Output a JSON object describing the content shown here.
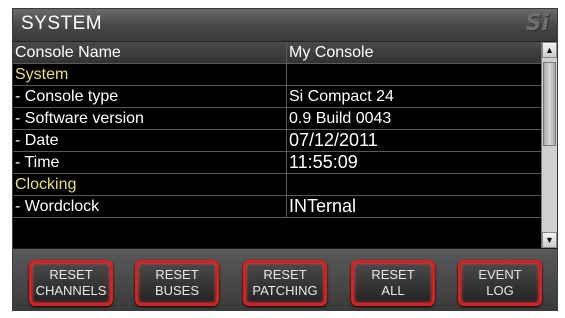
{
  "header": {
    "title": "SYSTEM",
    "logo_text": "Si"
  },
  "table": {
    "rows": [
      {
        "label": "Console Name",
        "value": "My Console"
      },
      {
        "label": "System",
        "value": ""
      },
      {
        "label": "- Console type",
        "value": "Si Compact 24"
      },
      {
        "label": "- Software version",
        "value": "0.9 Build 0043"
      },
      {
        "label": "- Date",
        "value": "07/12/2011"
      },
      {
        "label": "- Time",
        "value": "11:55:09"
      },
      {
        "label": "Clocking",
        "value": ""
      },
      {
        "label": "- Wordclock",
        "value": "INTernal"
      }
    ]
  },
  "scrollbar": {
    "up_icon": "arrow-up-icon",
    "down_icon": "arrow-down-icon",
    "up_glyph": "▲",
    "down_glyph": "▼"
  },
  "buttons": [
    {
      "line1": "RESET",
      "line2": "CHANNELS"
    },
    {
      "line1": "RESET",
      "line2": "BUSES"
    },
    {
      "line1": "RESET",
      "line2": "PATCHING"
    },
    {
      "line1": "RESET",
      "line2": "ALL"
    },
    {
      "line1": "EVENT",
      "line2": "LOG"
    }
  ],
  "colors": {
    "section_text": "#e8e06a",
    "button_border": "#d82020",
    "panel_bg": "#000000"
  }
}
